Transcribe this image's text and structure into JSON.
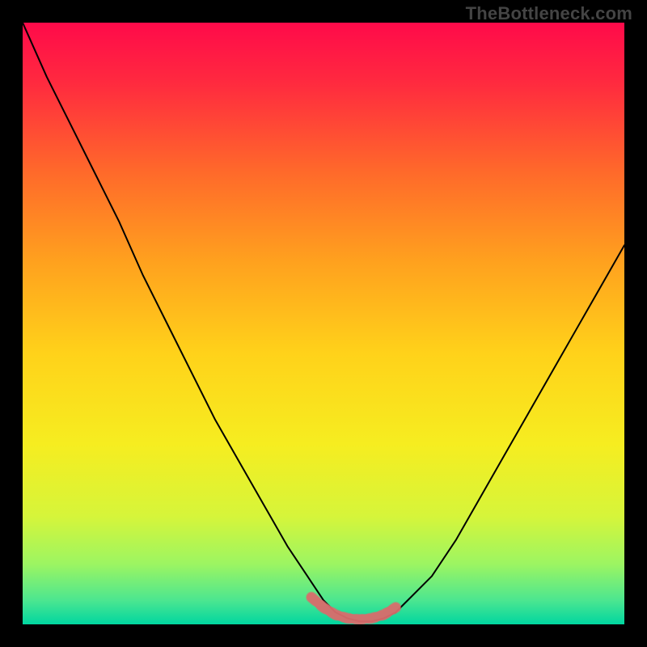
{
  "watermark": "TheBottleneck.com",
  "chart_data": {
    "type": "line",
    "title": "",
    "xlabel": "",
    "ylabel": "",
    "xlim": [
      0,
      100
    ],
    "ylim": [
      0,
      100
    ],
    "series": [
      {
        "name": "curve",
        "x": [
          0,
          4,
          8,
          12,
          16,
          20,
          24,
          28,
          32,
          36,
          40,
          44,
          48,
          50,
          52,
          54,
          56,
          58,
          60,
          62,
          64,
          68,
          72,
          76,
          80,
          84,
          88,
          92,
          96,
          100
        ],
        "y": [
          100,
          91,
          83,
          75,
          67,
          58,
          50,
          42,
          34,
          27,
          20,
          13,
          7,
          4,
          2,
          1,
          0.5,
          0.5,
          1,
          2,
          4,
          8,
          14,
          21,
          28,
          35,
          42,
          49,
          56,
          63
        ]
      },
      {
        "name": "highlight",
        "x": [
          48,
          50,
          52,
          54,
          56,
          58,
          60,
          62
        ],
        "y": [
          4.5,
          2.8,
          1.6,
          1.0,
          0.8,
          1.0,
          1.6,
          2.8
        ],
        "style": "thick-accent"
      }
    ],
    "background_gradient": {
      "stops": [
        {
          "pos": 0.0,
          "color": "#ff0a4a"
        },
        {
          "pos": 0.1,
          "color": "#ff2a3f"
        },
        {
          "pos": 0.25,
          "color": "#ff6a2a"
        },
        {
          "pos": 0.4,
          "color": "#ffa21e"
        },
        {
          "pos": 0.55,
          "color": "#ffd21a"
        },
        {
          "pos": 0.7,
          "color": "#f6ed20"
        },
        {
          "pos": 0.82,
          "color": "#d6f53a"
        },
        {
          "pos": 0.9,
          "color": "#9cf562"
        },
        {
          "pos": 0.96,
          "color": "#4ce690"
        },
        {
          "pos": 1.0,
          "color": "#00d6a0"
        }
      ]
    },
    "accent_color": "#d96b6b"
  }
}
